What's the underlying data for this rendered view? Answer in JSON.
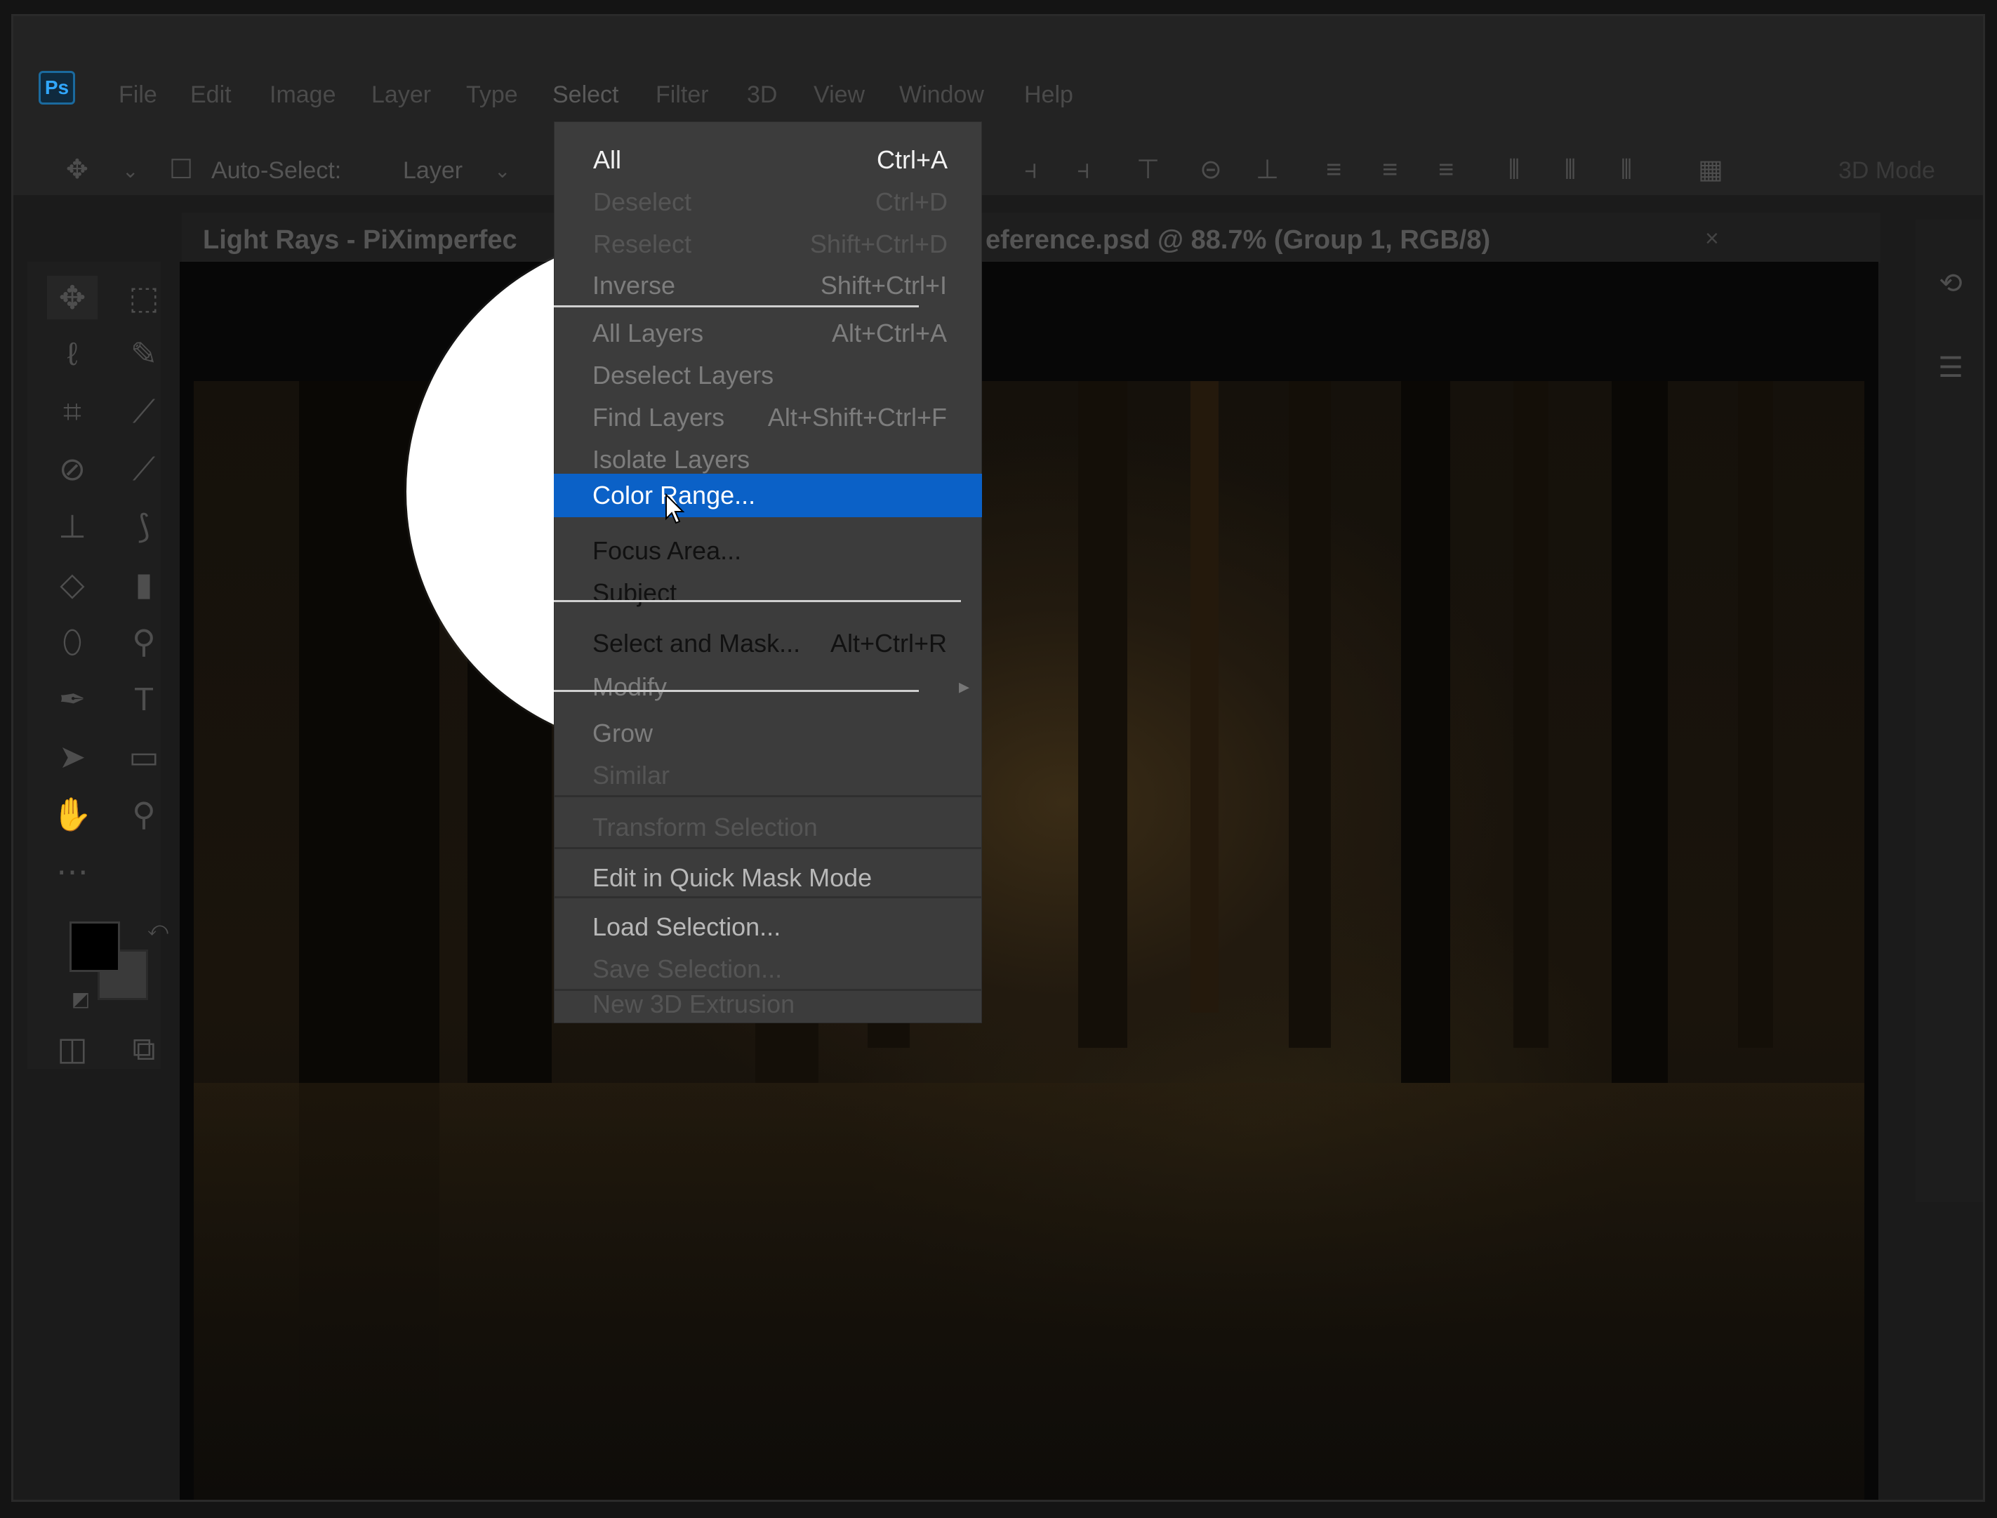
{
  "app": {
    "logo": "Ps",
    "menubar": [
      "File",
      "Edit",
      "Image",
      "Layer",
      "Type",
      "Select",
      "Filter",
      "3D",
      "View",
      "Window",
      "Help"
    ],
    "active_menu": "Select"
  },
  "options_bar": {
    "auto_select_label": "Auto-Select:",
    "auto_select_value": "Layer",
    "mode_3d": "3D Mode"
  },
  "document": {
    "tab_title": "Light Rays - PiXimperfect Reference.psd @ 88.7% (Group 1, RGB/8)",
    "tab_title_left": "Light Rays - PiXimperfec",
    "tab_title_right": "eference.psd @ 88.7% (Group 1, RGB/8)",
    "close_glyph": "×"
  },
  "select_menu": {
    "items": [
      {
        "label": "All",
        "shortcut": "Ctrl+A",
        "state": "enabled"
      },
      {
        "label": "Deselect",
        "shortcut": "Ctrl+D",
        "state": "disabled"
      },
      {
        "label": "Reselect",
        "shortcut": "Shift+Ctrl+D",
        "state": "disabled"
      },
      {
        "label": "Inverse",
        "shortcut": "Shift+Ctrl+I",
        "state": "disabled"
      },
      {
        "label": "All Layers",
        "shortcut": "Alt+Ctrl+A",
        "state": "enabled"
      },
      {
        "label": "Deselect Layers",
        "shortcut": "",
        "state": "enabled"
      },
      {
        "label": "Find Layers",
        "shortcut": "Alt+Shift+Ctrl+F",
        "state": "enabled"
      },
      {
        "label": "Isolate Layers",
        "shortcut": "",
        "state": "enabled"
      },
      {
        "label": "Color Range...",
        "shortcut": "",
        "state": "highlighted"
      },
      {
        "label": "Focus Area...",
        "shortcut": "",
        "state": "enabled"
      },
      {
        "label": "Subject",
        "shortcut": "",
        "state": "enabled"
      },
      {
        "label": "Select and Mask...",
        "shortcut": "Alt+Ctrl+R",
        "state": "enabled"
      },
      {
        "label": "Modify",
        "shortcut": "",
        "state": "disabled",
        "submenu": true
      },
      {
        "label": "Grow",
        "shortcut": "",
        "state": "disabled"
      },
      {
        "label": "Similar",
        "shortcut": "",
        "state": "disabled"
      },
      {
        "label": "Transform Selection",
        "shortcut": "",
        "state": "disabled"
      },
      {
        "label": "Edit in Quick Mask Mode",
        "shortcut": "",
        "state": "enabled"
      },
      {
        "label": "Load Selection...",
        "shortcut": "",
        "state": "enabled"
      },
      {
        "label": "Save Selection...",
        "shortcut": "",
        "state": "disabled"
      },
      {
        "label": "New 3D Extrusion",
        "shortcut": "",
        "state": "disabled"
      }
    ]
  },
  "colors": {
    "highlight": "#0b61c7",
    "menu_bg": "#3c3c3c",
    "lens_bg": "#ffffff",
    "ui_bg": "#232323"
  },
  "tools": [
    "move-icon",
    "marquee-icon",
    "lasso-icon",
    "quick-select-icon",
    "crop-icon",
    "eyedropper-icon",
    "healing-icon",
    "brush-icon",
    "stamp-icon",
    "history-brush-icon",
    "eraser-icon",
    "gradient-icon",
    "blur-icon",
    "dodge-icon",
    "pen-icon",
    "type-icon",
    "path-select-icon",
    "rectangle-icon",
    "hand-icon",
    "zoom-icon",
    "more-tools-icon"
  ]
}
